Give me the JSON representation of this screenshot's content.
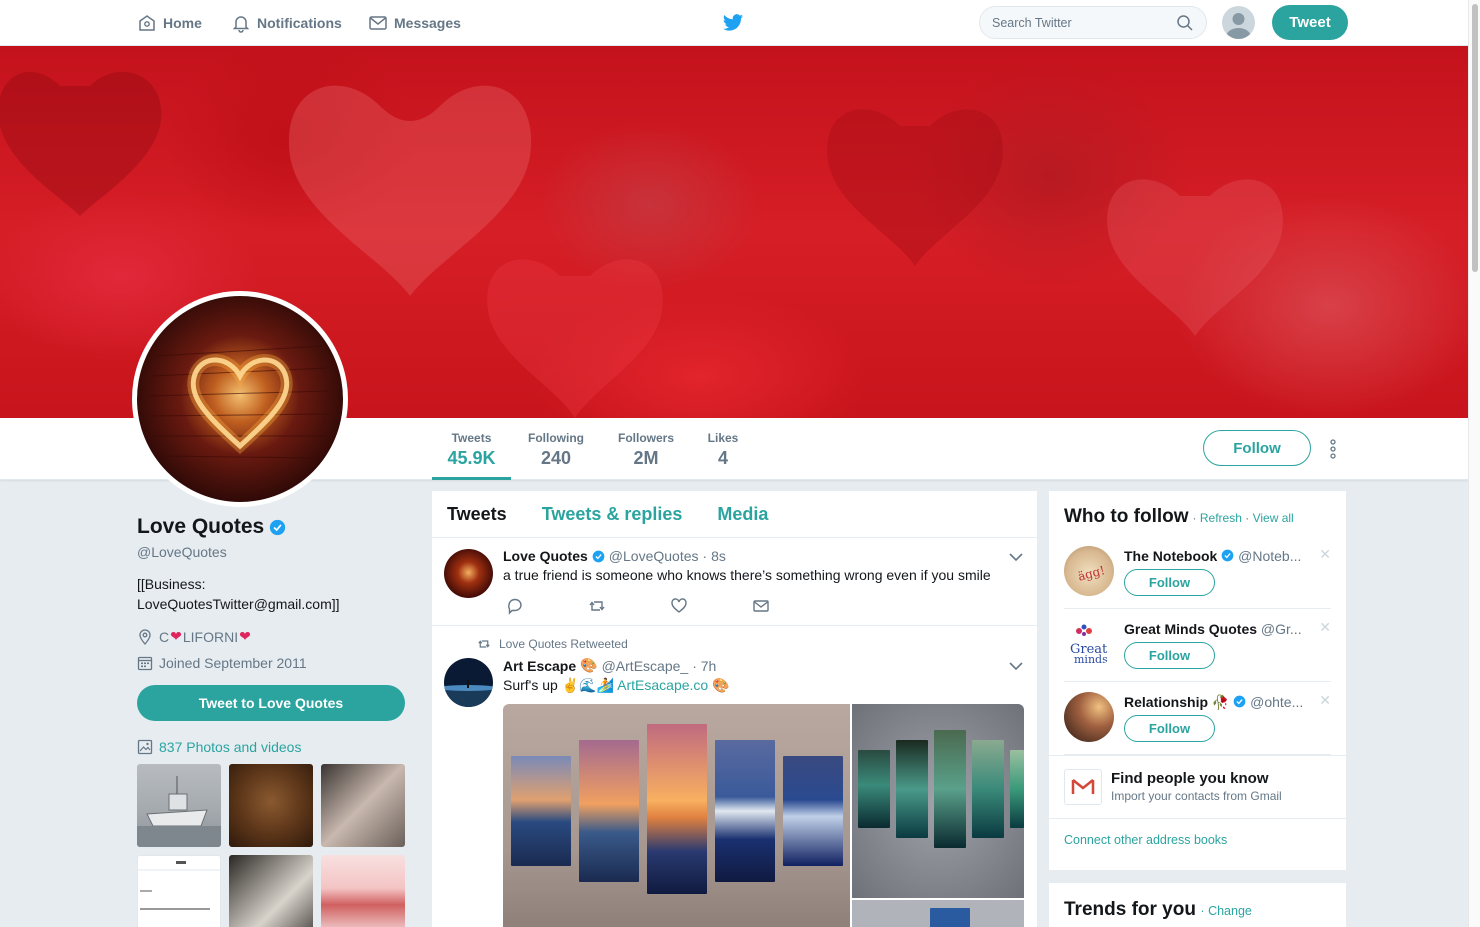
{
  "nav": {
    "home": "Home",
    "notifications": "Notifications",
    "messages": "Messages",
    "search_placeholder": "Search Twitter",
    "tweet_button": "Tweet",
    "logo_icon": "twitter-bird-icon"
  },
  "colors": {
    "accent": "#2ba4a0",
    "secondary_text": "#657786",
    "background": "#e6ecf0"
  },
  "profile": {
    "name": "Love Quotes",
    "handle": "@LoveQuotes",
    "bio": "[[Business: LoveQuotesTwitter@gmail.com]]",
    "location_prefix": "C",
    "location_suffix": "LIFORNI",
    "joined": "Joined September 2011",
    "tweet_to": "Tweet to Love Quotes",
    "photos": "837 Photos and videos"
  },
  "stats": [
    {
      "label": "Tweets",
      "value": "45.9K"
    },
    {
      "label": "Following",
      "value": "240"
    },
    {
      "label": "Followers",
      "value": "2M"
    },
    {
      "label": "Likes",
      "value": "4"
    }
  ],
  "follow_button": "Follow",
  "tabs": [
    "Tweets",
    "Tweets & replies",
    "Media"
  ],
  "tweets": [
    {
      "name": "Love Quotes",
      "handle": "@LoveQuotes",
      "time": "· 8s",
      "text": "a true friend is someone who knows there’s something wrong even if you smile"
    },
    {
      "retweeted_by": "Love Quotes Retweeted",
      "name": "Art Escape",
      "handle": "@ArtEscape_",
      "time": "· 7h",
      "text": "Surf's up",
      "link": "ArtEsacape.co"
    }
  ],
  "who_to_follow": {
    "title": "Who to follow",
    "refresh": "Refresh",
    "view_all": "View all",
    "suggestions": [
      {
        "name": "The Notebook",
        "handle": "@Noteb...",
        "verified": true,
        "follow": "Follow"
      },
      {
        "name": "Great Minds Quotes",
        "handle": "@Gr...",
        "verified": false,
        "follow": "Follow"
      },
      {
        "name": "Relationship",
        "handle": "@ohte...",
        "verified": true,
        "follow": "Follow"
      }
    ],
    "find_title": "Find people you know",
    "find_sub": "Import your contacts from Gmail",
    "connect": "Connect other address books"
  },
  "trends": {
    "title": "Trends for you",
    "change": "Change"
  }
}
